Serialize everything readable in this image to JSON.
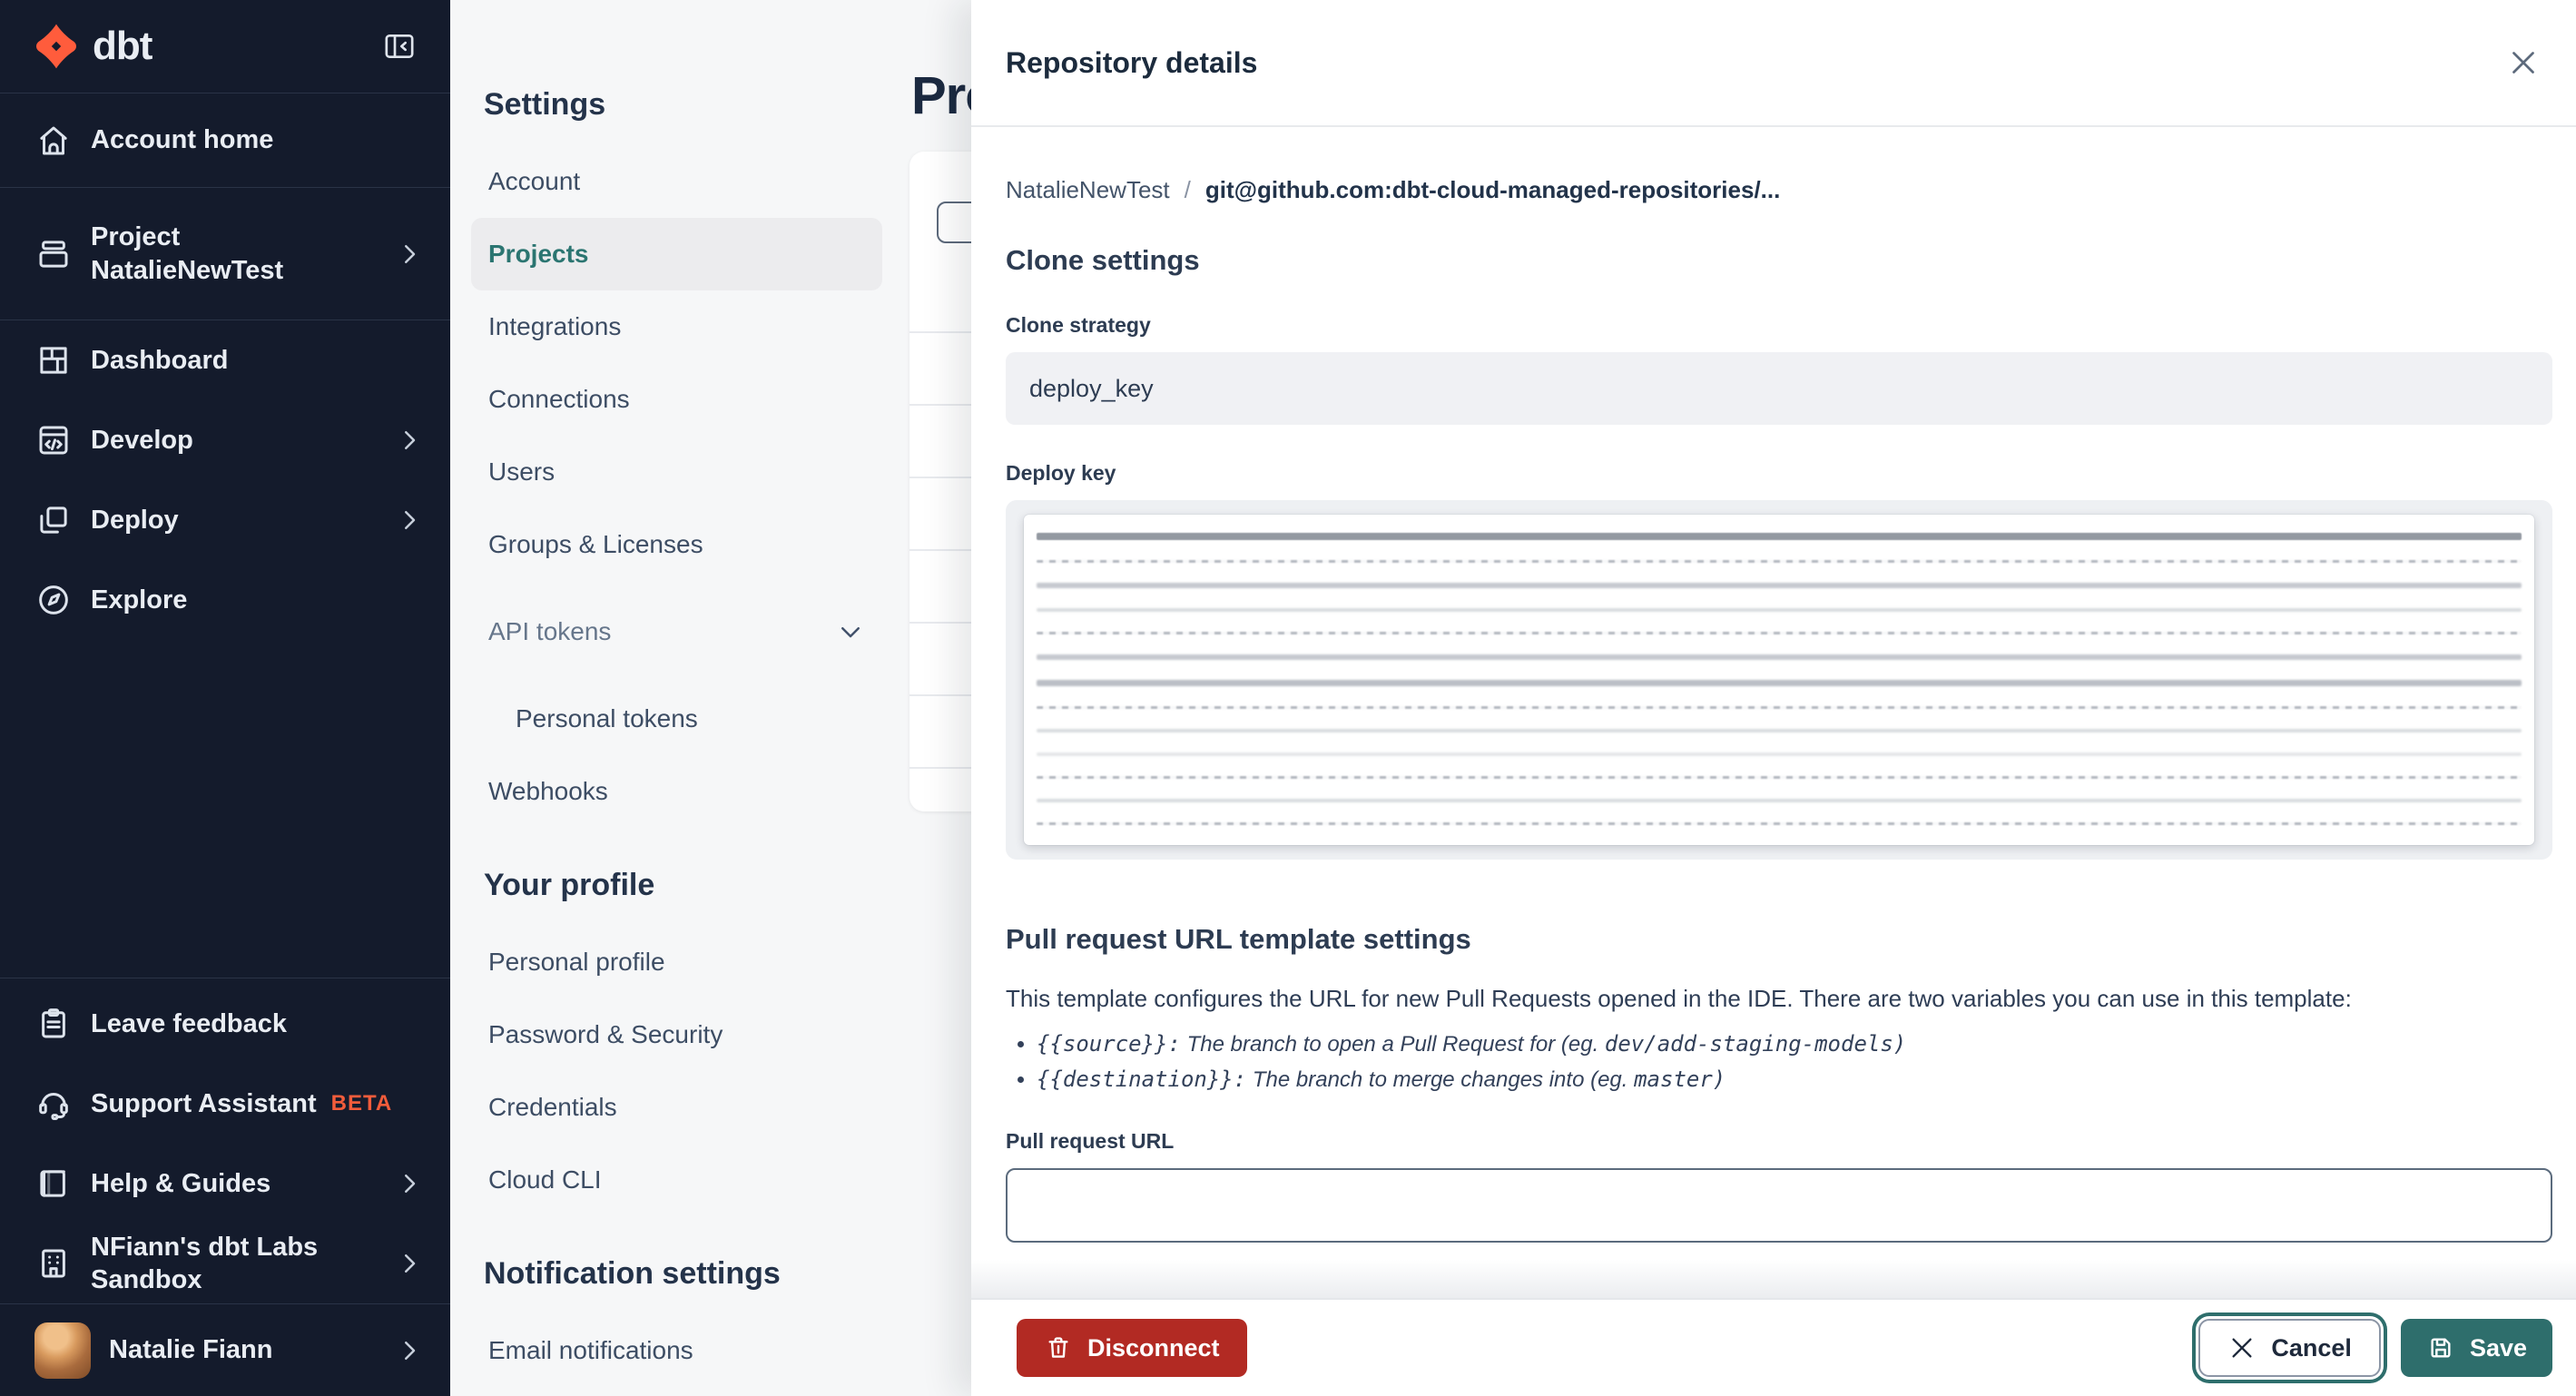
{
  "colors": {
    "brand_orange": "#ff5c3c",
    "accent_teal": "#2e6e6c",
    "selected_nav_text": "#2b7571",
    "danger_red": "#b22a23",
    "beta_badge": "#f25c3b",
    "sidebar_bg": "#141b2c"
  },
  "app": {
    "brand": "dbt"
  },
  "sidebar": {
    "items": [
      {
        "label": "Account home"
      },
      {
        "label": "Project",
        "sublabel": "NatalieNewTest"
      },
      {
        "label": "Dashboard"
      },
      {
        "label": "Develop"
      },
      {
        "label": "Deploy"
      },
      {
        "label": "Explore"
      }
    ],
    "footer_items": [
      {
        "label": "Leave feedback"
      },
      {
        "label": "Support Assistant",
        "badge": "BETA"
      },
      {
        "label": "Help & Guides"
      },
      {
        "label": "NFiann's dbt Labs Sandbox"
      }
    ],
    "user": {
      "name": "Natalie Fiann"
    }
  },
  "settings_nav": {
    "title": "Settings",
    "items": [
      {
        "label": "Account"
      },
      {
        "label": "Projects"
      },
      {
        "label": "Integrations"
      },
      {
        "label": "Connections"
      },
      {
        "label": "Users"
      },
      {
        "label": "Groups & Licenses"
      },
      {
        "label": "API tokens"
      },
      {
        "label": "Personal tokens"
      },
      {
        "label": "Webhooks"
      }
    ],
    "profile_title": "Your profile",
    "profile_items": [
      {
        "label": "Personal profile"
      },
      {
        "label": "Password & Security"
      },
      {
        "label": "Credentials"
      },
      {
        "label": "Cloud CLI"
      }
    ],
    "notifications_title": "Notification settings",
    "notification_items": [
      {
        "label": "Email notifications"
      }
    ]
  },
  "main": {
    "title": "Projects"
  },
  "panel": {
    "title": "Repository details",
    "breadcrumb": {
      "project": "NatalieNewTest",
      "separator": "/",
      "repo": "git@github.com:dbt-cloud-managed-repositories/..."
    },
    "clone_settings": {
      "heading": "Clone settings",
      "strategy_label": "Clone strategy",
      "strategy_value": "deploy_key",
      "deploy_key_label": "Deploy key"
    },
    "pr_template": {
      "heading": "Pull request URL template settings",
      "description": "This template configures the URL for new Pull Requests opened in the IDE. There are two variables you can use in this template:",
      "bullets": [
        {
          "code": "{{source}}:",
          "desc": " The branch to open a Pull Request for (eg. ",
          "example": "dev/add-staging-models)"
        },
        {
          "code": "{{destination}}:",
          "desc": " The branch to merge changes into (eg. ",
          "example": "master)"
        }
      ],
      "url_label": "Pull request URL",
      "url_value": ""
    },
    "footer": {
      "disconnect_label": "Disconnect",
      "cancel_label": "Cancel",
      "save_label": "Save"
    }
  }
}
